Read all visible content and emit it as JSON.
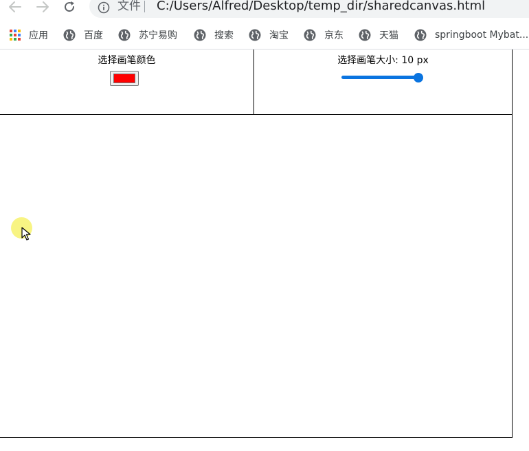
{
  "browser": {
    "chip_label": "文件",
    "url": "C:/Users/Alfred/Desktop/temp_dir/sharedcanvas.html",
    "icons": {
      "back": "back-arrow-icon",
      "forward": "forward-arrow-icon",
      "reload": "reload-icon",
      "info": "info-icon"
    }
  },
  "bookmarks": {
    "apps_label": "应用",
    "items": [
      {
        "label": "百度",
        "icon": "globe-icon"
      },
      {
        "label": "苏宁易购",
        "icon": "globe-icon"
      },
      {
        "label": "搜索",
        "icon": "globe-icon"
      },
      {
        "label": "淘宝",
        "icon": "globe-icon"
      },
      {
        "label": "京东",
        "icon": "globe-icon"
      },
      {
        "label": "天猫",
        "icon": "globe-icon"
      },
      {
        "label": "springboot Mybat...",
        "icon": "globe-icon"
      }
    ]
  },
  "page": {
    "color_picker": {
      "label": "选择画笔颜色",
      "value": "#ff0000"
    },
    "size_picker": {
      "label": "选择画笔大小: 10 px",
      "value": 10,
      "fill_fraction": 1.0
    }
  },
  "colors": {
    "accent": "#0a74e0",
    "slider_track": "#0a74e0",
    "pen_color": "#ff0000",
    "cursor_highlight": "#f5f05a"
  }
}
